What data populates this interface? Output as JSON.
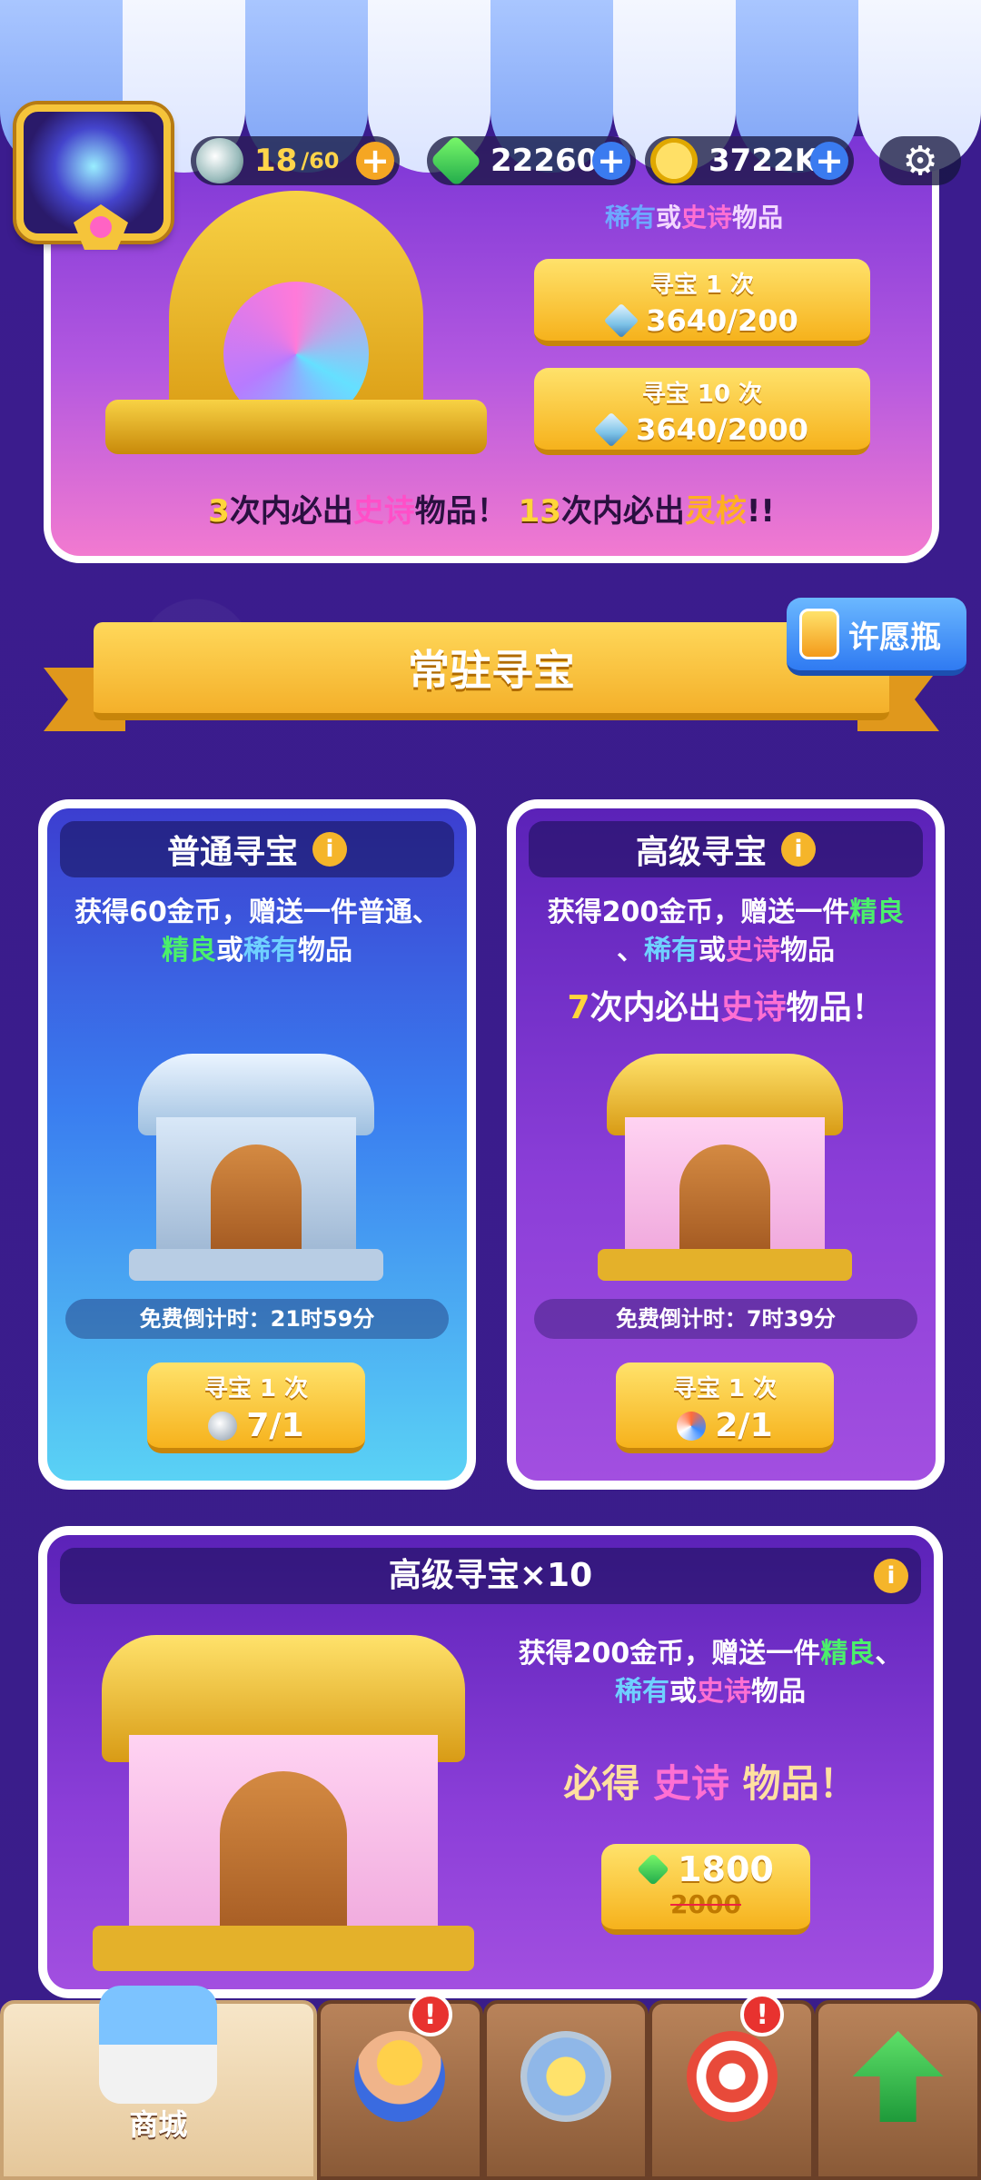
{
  "top_bar": {
    "stamina": {
      "value": "18",
      "max": "/60"
    },
    "gems": "22260",
    "gold": "3722K",
    "settings_icon": "gear-icon"
  },
  "event": {
    "pool_text_prefix": "稀有",
    "pool_text_or": "或",
    "pool_text_epic": "史诗",
    "pool_text_suffix": "物品",
    "draw1_label": "寻宝 1 次",
    "draw1_cost": "3640/200",
    "draw10_label": "寻宝 10 次",
    "draw10_cost": "3640/2000",
    "guar_n1": "3",
    "guar_t1": "次内必出",
    "guar_epic": "史诗",
    "guar_t2": "物品！",
    "guar_n2": "13",
    "guar_t3": "次内必出",
    "guar_core": "灵核",
    "guar_t4": "!!"
  },
  "section": {
    "title": "常驻寻宝",
    "wish_label": "许愿瓶"
  },
  "normal_card": {
    "title": "普通寻宝",
    "desc_line1": "获得60金币，赠送一件普通、",
    "desc_green": "精良",
    "desc_or": "或",
    "desc_blue": "稀有",
    "desc_end": "物品",
    "timer": "免费倒计时：21时59分",
    "btn_label": "寻宝 1 次",
    "btn_cost": "7/1"
  },
  "adv_card": {
    "title": "高级寻宝",
    "desc_line1": "获得200金币，赠送一件",
    "desc_green": "精良",
    "desc_sep": "、",
    "desc_blue": "稀有",
    "desc_or": "或",
    "desc_pink": "史诗",
    "desc_end": "物品",
    "guar_num": "7",
    "guar_t1": "次内必出",
    "guar_epic": "史诗",
    "guar_t2": "物品！",
    "timer": "免费倒计时：7时39分",
    "btn_label": "寻宝 1 次",
    "btn_cost": "2/1"
  },
  "big_card": {
    "title": "高级寻宝×10",
    "desc_line1": "获得200金币，赠送一件",
    "desc_green": "精良",
    "desc_sep": "、",
    "desc_blue": "稀有",
    "desc_or": "或",
    "desc_pink": "史诗",
    "desc_end": "物品",
    "guar_t1": "必得",
    "guar_epic": "史诗",
    "guar_t2": "物品！",
    "price_now": "1800",
    "price_old": "2000"
  },
  "bottom_nav": {
    "shop_label": "商城",
    "badge": "!"
  }
}
